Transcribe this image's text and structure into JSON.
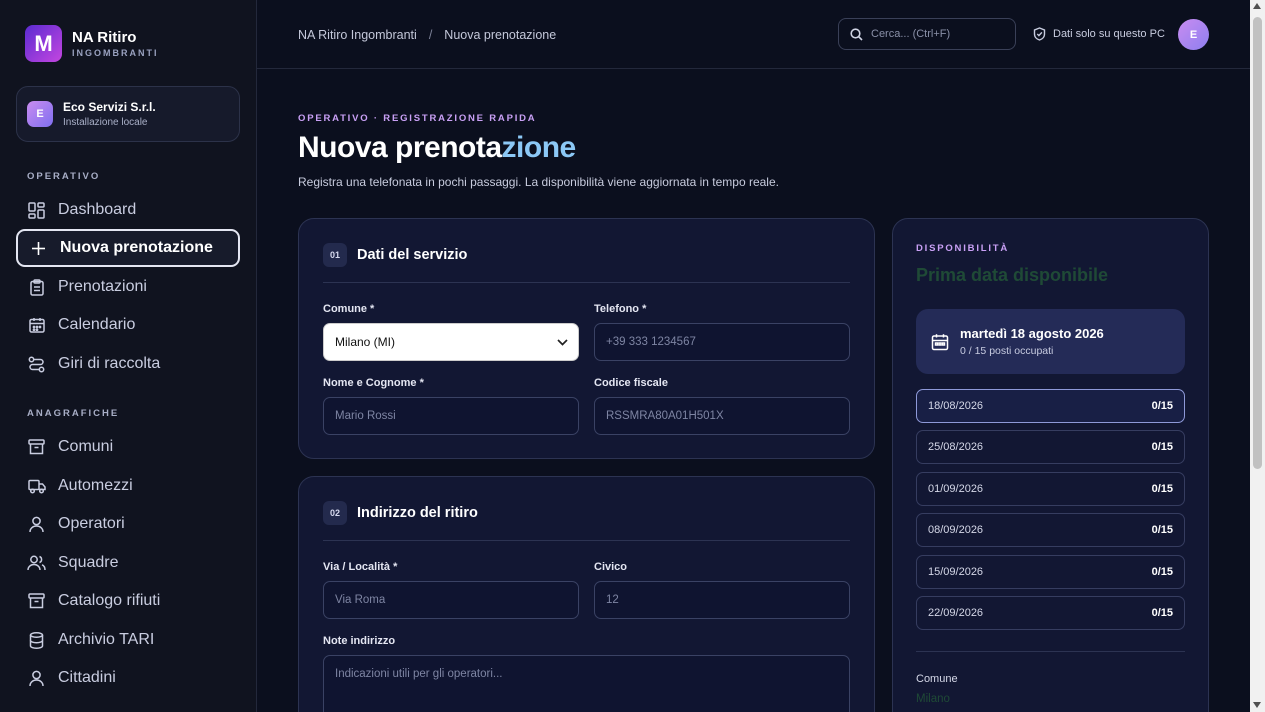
{
  "brand": {
    "logo": "M",
    "name": "NA Ritiro",
    "subtitle": "INGOMBRANTI"
  },
  "org": {
    "avatar": "E",
    "name": "Eco Servizi S.r.l.",
    "subtitle": "Installazione locale"
  },
  "sidebar": {
    "sections": [
      {
        "label": "OPERATIVO"
      },
      {
        "label": "ANAGRAFICHE"
      }
    ],
    "items": [
      {
        "label": "Dashboard",
        "icon": "grid-icon"
      },
      {
        "label": "Nuova prenotazione",
        "icon": "plus-icon",
        "active": true
      },
      {
        "label": "Prenotazioni",
        "icon": "clipboard-icon"
      },
      {
        "label": "Calendario",
        "icon": "calendar-icon"
      },
      {
        "label": "Giri di raccolta",
        "icon": "route-icon"
      },
      {
        "label": "Comuni",
        "icon": "archive-icon"
      },
      {
        "label": "Automezzi",
        "icon": "truck-icon"
      },
      {
        "label": "Operatori",
        "icon": "user-icon"
      },
      {
        "label": "Squadre",
        "icon": "users-icon"
      },
      {
        "label": "Catalogo rifiuti",
        "icon": "archive-icon"
      },
      {
        "label": "Archivio TARI",
        "icon": "database-icon"
      },
      {
        "label": "Cittadini",
        "icon": "user-icon"
      }
    ]
  },
  "topbar": {
    "breadcrumb": [
      "NA Ritiro Ingombranti",
      "/",
      "Nuova prenotazione"
    ],
    "search_placeholder": "Cerca... (Ctrl+F)",
    "local_label": "Dati solo su questo PC",
    "user_avatar": "E"
  },
  "page": {
    "kicker": "OPERATIVO · REGISTRAZIONE RAPIDA",
    "title_main": "Nuova prenota",
    "title_accent": "zione",
    "subtitle": "Registra una telefonata in pochi passaggi. La disponibilità viene aggiornata in tempo reale."
  },
  "service": {
    "number": "01",
    "title": "Dati del servizio",
    "comune_label": "Comune *",
    "comune_value": "Milano (MI)",
    "telefono_label": "Telefono *",
    "telefono_placeholder": "+39 333 1234567",
    "nome_label": "Nome e Cognome *",
    "nome_placeholder": "Mario Rossi",
    "cf_label": "Codice fiscale",
    "cf_placeholder": "RSSMRA80A01H501X"
  },
  "address": {
    "number": "02",
    "title": "Indirizzo del ritiro",
    "via_label": "Via / Località *",
    "via_placeholder": "Via Roma",
    "civico_label": "Civico",
    "civico_placeholder": "12",
    "note_label": "Note indirizzo",
    "note_placeholder": "Indicazioni utili per gli operatori..."
  },
  "availability": {
    "kicker": "DISPONIBILITÀ",
    "title": "Prima data disponibile",
    "first_day": "martedì 18 agosto 2026",
    "first_occupancy": "0 / 15 posti occupati",
    "slots": [
      {
        "date": "18/08/2026",
        "count": "0/15",
        "selected": true
      },
      {
        "date": "25/08/2026",
        "count": "0/15"
      },
      {
        "date": "01/09/2026",
        "count": "0/15"
      },
      {
        "date": "08/09/2026",
        "count": "0/15"
      },
      {
        "date": "15/09/2026",
        "count": "0/15"
      },
      {
        "date": "22/09/2026",
        "count": "0/15"
      }
    ],
    "comune_label": "Comune",
    "comune_value": "Milano"
  },
  "colors": {
    "accent_purple": "#c9a0f5",
    "accent_blue": "#8cc8f6",
    "bg": "#0b0f1e"
  }
}
